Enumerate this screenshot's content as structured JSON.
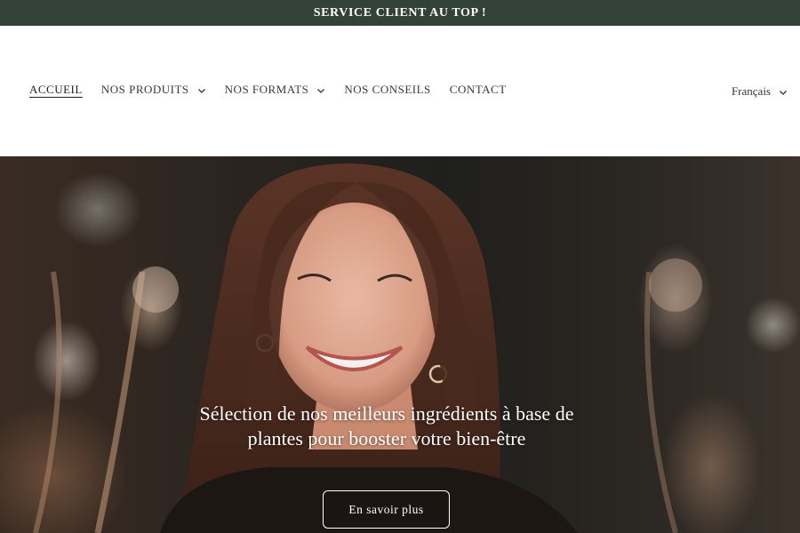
{
  "announcement": {
    "text": "SERVICE CLIENT AU TOP !"
  },
  "nav": {
    "items": [
      {
        "label": "ACCUEIL",
        "active": true,
        "dropdown": false
      },
      {
        "label": "NOS PRODUITS",
        "active": false,
        "dropdown": true
      },
      {
        "label": "NOS FORMATS",
        "active": false,
        "dropdown": true
      },
      {
        "label": "NOS CONSEILS",
        "active": false,
        "dropdown": false
      },
      {
        "label": "CONTACT",
        "active": false,
        "dropdown": false
      }
    ]
  },
  "language": {
    "selected": "Français"
  },
  "hero": {
    "title": "Sélection de nos meilleurs ingrédients à base de plantes pour booster votre bien-être",
    "button_label": "En savoir plus"
  },
  "colors": {
    "announcement_bg": "#334239",
    "announcement_text": "#ffffff",
    "nav_text": "#3a3a3a"
  }
}
